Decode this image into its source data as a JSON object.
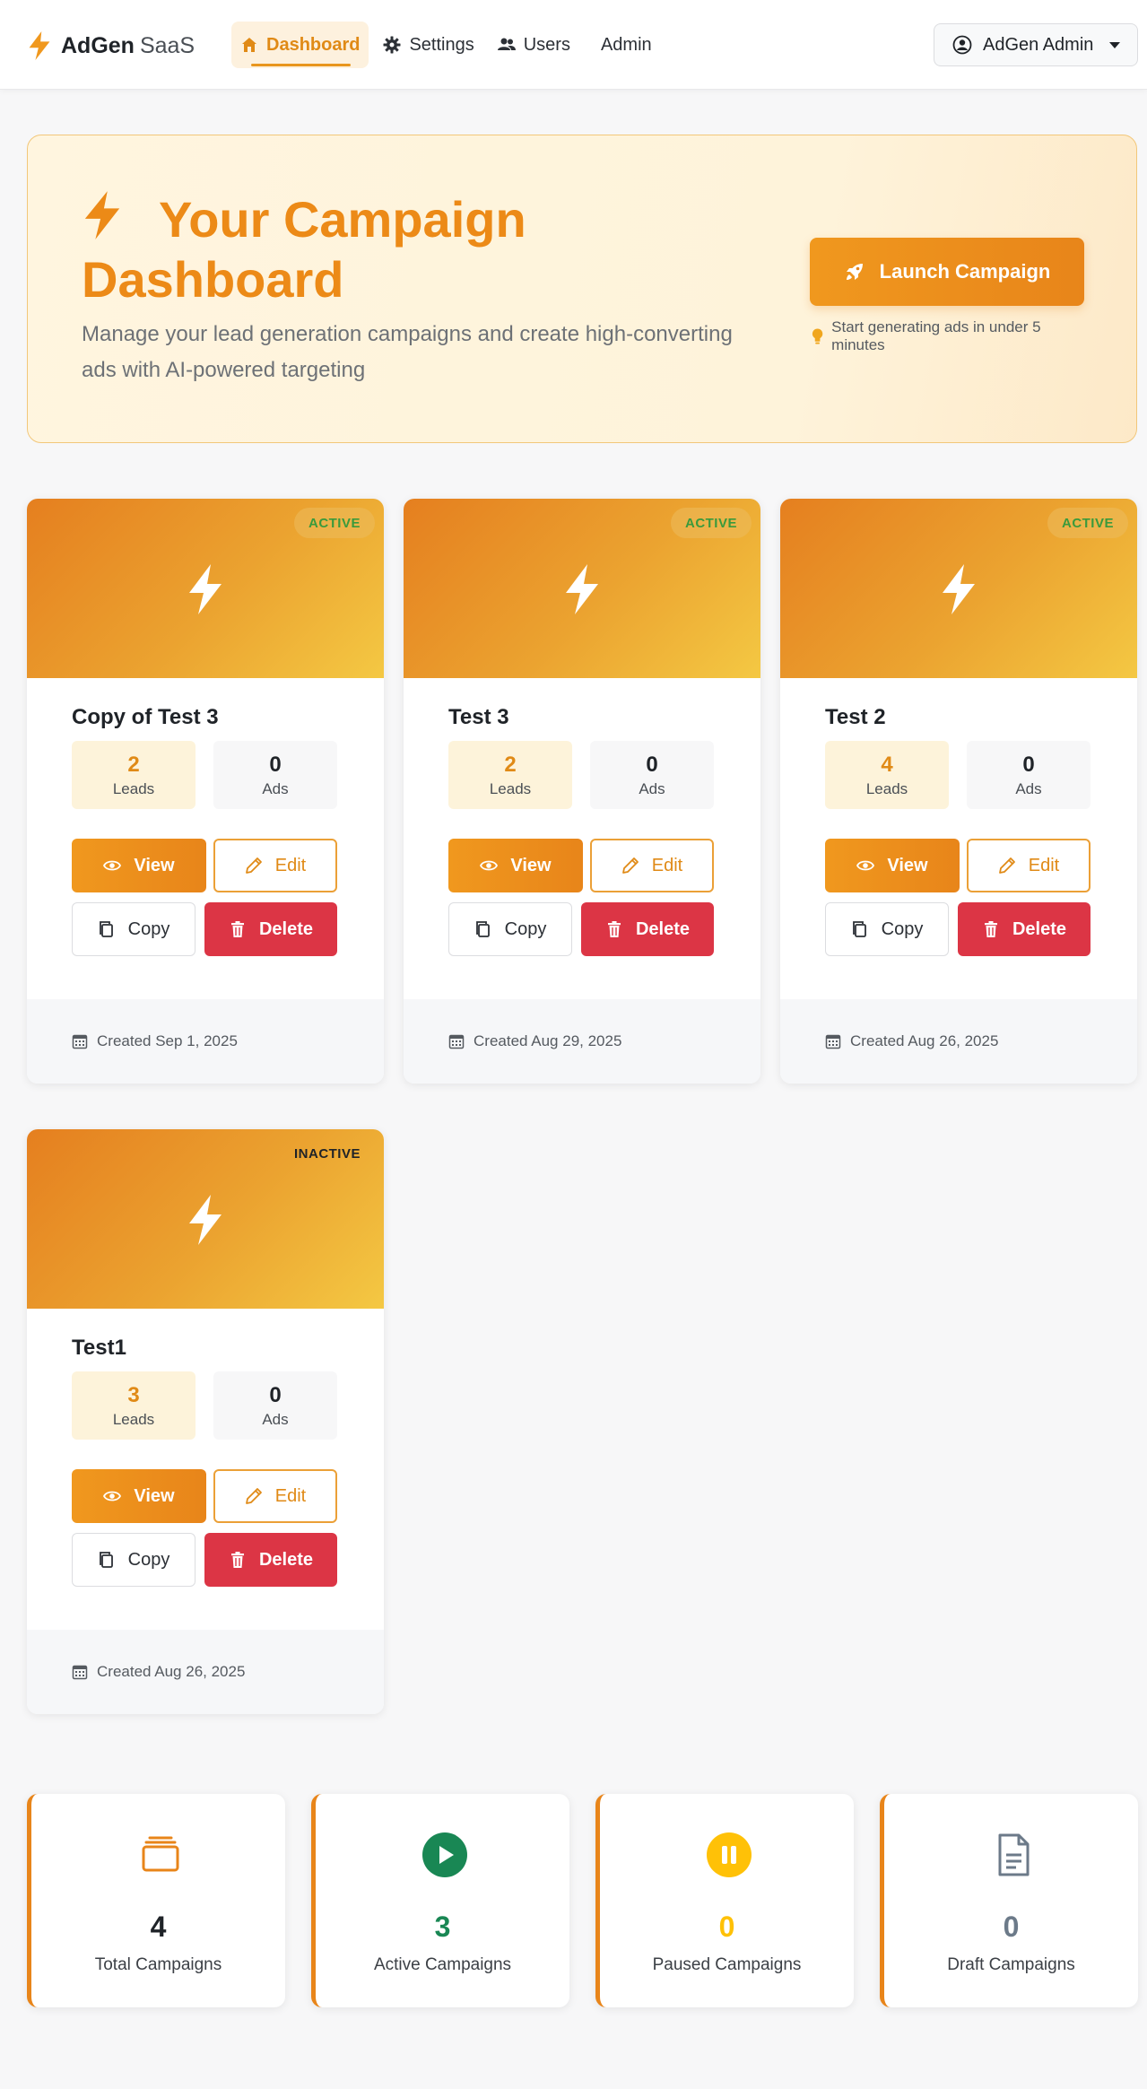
{
  "navbar": {
    "brand_name": "AdGen",
    "brand_suffix": "SaaS",
    "items": [
      {
        "label": "Dashboard",
        "icon": "home-icon",
        "active": true
      },
      {
        "label": "Settings",
        "icon": "gear-icon",
        "active": false
      },
      {
        "label": "Users",
        "icon": "users-icon",
        "active": false
      },
      {
        "label": "Admin",
        "icon": "",
        "active": false
      }
    ],
    "user_label": "AdGen Admin"
  },
  "hero": {
    "title": "Your Campaign Dashboard",
    "subtitle": "Manage your lead generation campaigns and create high-converting ads with AI-powered targeting",
    "launch_label": "Launch Campaign",
    "hint": "Start generating ads in under 5 minutes"
  },
  "campaigns": [
    {
      "title": "Copy of Test 3",
      "status": "ACTIVE",
      "leads": "2",
      "ads": "0",
      "created": "Created Sep 1, 2025"
    },
    {
      "title": "Test 3",
      "status": "ACTIVE",
      "leads": "2",
      "ads": "0",
      "created": "Created Aug 29, 2025"
    },
    {
      "title": "Test 2",
      "status": "ACTIVE",
      "leads": "4",
      "ads": "0",
      "created": "Created Aug 26, 2025"
    },
    {
      "title": "Test1",
      "status": "INACTIVE",
      "leads": "3",
      "ads": "0",
      "created": "Created Aug 26, 2025"
    }
  ],
  "labels": {
    "leads": "Leads",
    "ads": "Ads",
    "view": "View",
    "edit": "Edit",
    "copy": "Copy",
    "delete": "Delete"
  },
  "summary": [
    {
      "value": "4",
      "label": "Total Campaigns",
      "icon": "stack-icon",
      "color": "#1f2328"
    },
    {
      "value": "3",
      "label": "Active Campaigns",
      "icon": "play-icon",
      "color": "#198754"
    },
    {
      "value": "0",
      "label": "Paused Campaigns",
      "icon": "pause-icon",
      "color": "#ffc107"
    },
    {
      "value": "0",
      "label": "Draft Campaigns",
      "icon": "document-icon",
      "color": "#6c7a89"
    }
  ],
  "colors": {
    "accent": "#e8851a",
    "danger": "#dc3545",
    "success": "#198754",
    "warning": "#ffc107"
  }
}
